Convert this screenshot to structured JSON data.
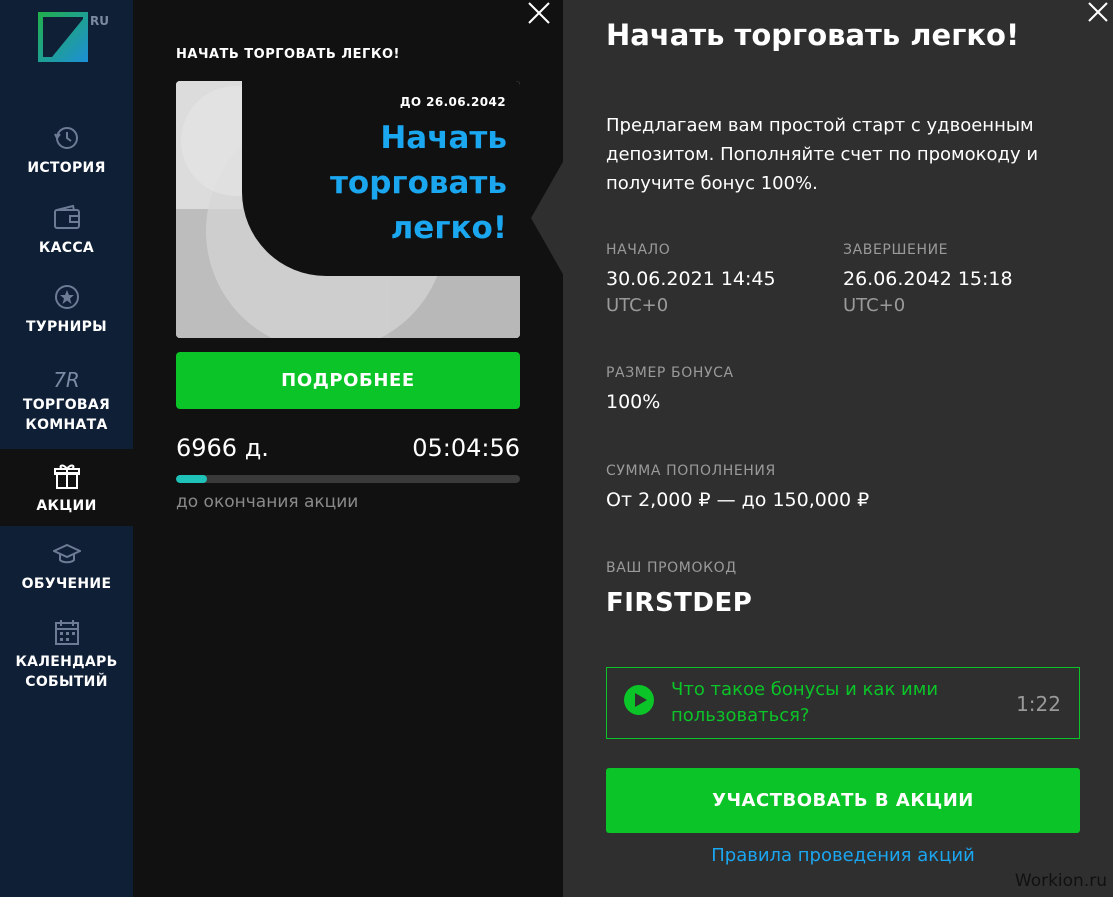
{
  "sidebar": {
    "logo_suffix": "RU",
    "items": [
      {
        "label": "ИСТОРИЯ",
        "icon": "history-icon"
      },
      {
        "label": "КАССА",
        "icon": "wallet-icon"
      },
      {
        "label": "ТУРНИРЫ",
        "icon": "star-icon"
      },
      {
        "label": "ТОРГОВАЯ\nКОМНАТА",
        "icon_text": "7R"
      },
      {
        "label": "АКЦИИ",
        "icon": "gift-icon",
        "active": true
      },
      {
        "label": "ОБУЧЕНИЕ",
        "icon": "graduation-cap-icon"
      },
      {
        "label": "КАЛЕНДАРЬ\nСОБЫТИЙ",
        "icon": "calendar-icon"
      }
    ]
  },
  "promo": {
    "heading": "НАЧАТЬ ТОРГОВАТЬ ЛЕГКО!",
    "banner_until": "ДО 26.06.2042",
    "banner_title": "Начать торговать легко!",
    "more_button": "ПОДРОБНЕЕ",
    "days_left": "6966 д.",
    "time_left": "05:04:56",
    "progress_fraction": 0.09,
    "until_end_label": "до окончания акции"
  },
  "details": {
    "title": "Начать торговать легко!",
    "description": "Предлагаем вам простой старт с удвоенным депозитом. Пополняйте счет по промокоду и получите бонус 100%.",
    "start_label": "НАЧАЛО",
    "start_value": "30.06.2021 14:45",
    "start_tz": "UTC+0",
    "end_label": "ЗАВЕРШЕНИЕ",
    "end_value": "26.06.2042 15:18",
    "end_tz": "UTC+0",
    "bonus_label": "РАЗМЕР БОНУСА",
    "bonus_value": "100%",
    "deposit_label": "СУММА ПОПОЛНЕНИЯ",
    "deposit_value": "От 2,000 ₽ — до 150,000 ₽",
    "promo_label": "ВАШ ПРОМОКОД",
    "promo_code": "FIRSTDEP",
    "video_text": "Что такое бонусы и как ими пользоваться?",
    "video_duration": "1:22",
    "join_button": "УЧАСТВОВАТЬ В АКЦИИ",
    "rules_link": "Правила проведения акций"
  },
  "watermark": "Workion.ru",
  "colors": {
    "accent_green": "#0bc427",
    "accent_blue": "#1ba6f0",
    "sidebar_bg": "#0f1f36",
    "panel_bg": "#2f2f2f"
  }
}
